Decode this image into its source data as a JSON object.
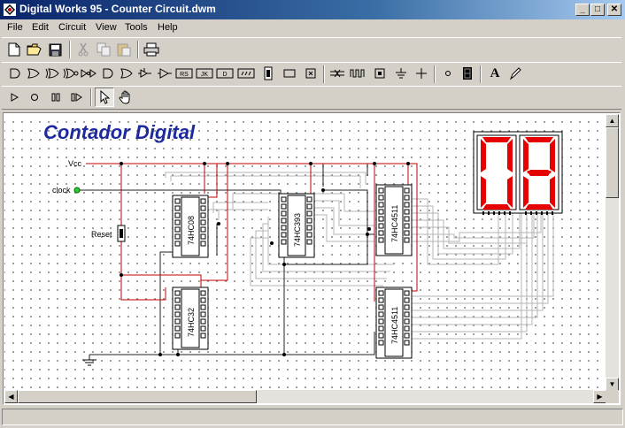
{
  "window": {
    "title": "Digital Works 95 - Counter Circuit.dwm",
    "controls": {
      "minimize": "_",
      "maximize": "□",
      "close": "✕"
    }
  },
  "menu": [
    "File",
    "Edit",
    "Circuit",
    "View",
    "Tools",
    "Help"
  ],
  "toolbar1": {
    "icons": [
      "new-file-icon",
      "open-folder-icon",
      "save-disk-icon",
      "cut-icon",
      "copy-icon",
      "paste-icon",
      "print-icon"
    ]
  },
  "toolbar2": {
    "icons": [
      "and-gate-icon",
      "or-gate-icon",
      "xor-gate-icon",
      "xnor-gate-icon",
      "inverter-chain-icon",
      "nand-gate-icon",
      "buffer-icon",
      "tristate-buffer-icon",
      "rs-flipflop-icon",
      "jk-flipflop-icon",
      "d-flipflop-icon",
      "register-icon",
      "ic-chip-icon",
      "rectangle-icon",
      "x-box-icon",
      "bus-icon",
      "clock-pulse-icon",
      "switch-icon",
      "ground-icon",
      "junction-icon",
      "point-icon",
      "seven-segment-icon",
      "text-tool-icon",
      "pen-tool-icon"
    ],
    "labels": {
      "rs": "RS",
      "jk": "JK",
      "d": "D",
      "text": "A"
    }
  },
  "toolbar3": {
    "icons": [
      "play-icon",
      "record-icon",
      "pause-icon",
      "step-icon",
      "pointer-icon",
      "hand-icon"
    ]
  },
  "circuit": {
    "title": "Contador Digital",
    "labels": {
      "vcc": "Vcc",
      "clock": "clock",
      "reset": "Reset"
    },
    "chips": [
      "74HC08",
      "74HC32",
      "74HC393",
      "74HC4511",
      "74HC4511"
    ],
    "display_value": "08"
  },
  "colors": {
    "title_blue": "#1c2a9c",
    "wire_red": "#c00000",
    "wire_dark": "#202020",
    "wire_gray": "#b0b0b0",
    "segment_red": "#e60000",
    "titlebar": "#0a246a"
  }
}
